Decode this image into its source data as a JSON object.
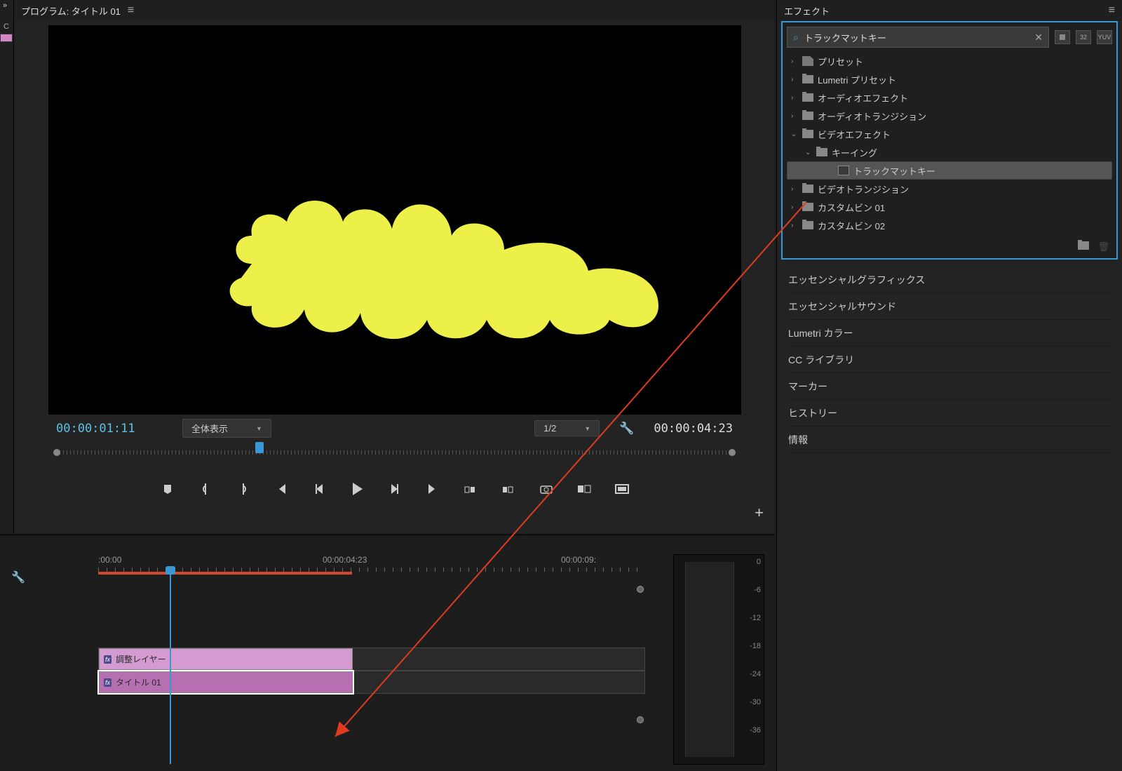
{
  "program": {
    "title": "プログラム: タイトル 01",
    "timecode_left": "00:00:01:11",
    "zoom_label": "全体表示",
    "resolution_label": "1/2",
    "timecode_right": "00:00:04:23"
  },
  "timeline": {
    "ticks": [
      ":00:00",
      "00:00:04:23",
      "00:00:09:"
    ],
    "clip1": {
      "fx": "fx",
      "label": "調整レイヤー"
    },
    "clip2": {
      "fx": "fx",
      "label": "タイトル 01"
    }
  },
  "meter_labels": [
    "0",
    "-6",
    "-12",
    "-18",
    "-24",
    "-30",
    "-36"
  ],
  "effects": {
    "title": "エフェクト",
    "search": "トラックマットキー",
    "badges": [
      "",
      "32",
      "YUV"
    ],
    "tree": [
      {
        "type": "preset",
        "label": "プリセット",
        "ind": 0,
        "chev": ">"
      },
      {
        "type": "folder",
        "label": "Lumetri プリセット",
        "ind": 0,
        "chev": ">"
      },
      {
        "type": "folder",
        "label": "オーディオエフェクト",
        "ind": 0,
        "chev": ">"
      },
      {
        "type": "folder",
        "label": "オーディオトランジション",
        "ind": 0,
        "chev": ">"
      },
      {
        "type": "folder",
        "label": "ビデオエフェクト",
        "ind": 0,
        "chev": "v"
      },
      {
        "type": "folder",
        "label": "キーイング",
        "ind": 1,
        "chev": "v"
      },
      {
        "type": "fx",
        "label": "トラックマットキー",
        "ind": 2,
        "sel": true
      },
      {
        "type": "folder",
        "label": "ビデオトランジション",
        "ind": 0,
        "chev": ">"
      },
      {
        "type": "folder",
        "label": "カスタムビン 01",
        "ind": 0,
        "chev": ">"
      },
      {
        "type": "folder",
        "label": "カスタムビン 02",
        "ind": 0,
        "chev": ">"
      }
    ]
  },
  "side_panels": [
    "エッセンシャルグラフィックス",
    "エッセンシャルサウンド",
    "Lumetri カラー",
    "CC ライブラリ",
    "マーカー",
    "ヒストリー",
    "情報"
  ]
}
